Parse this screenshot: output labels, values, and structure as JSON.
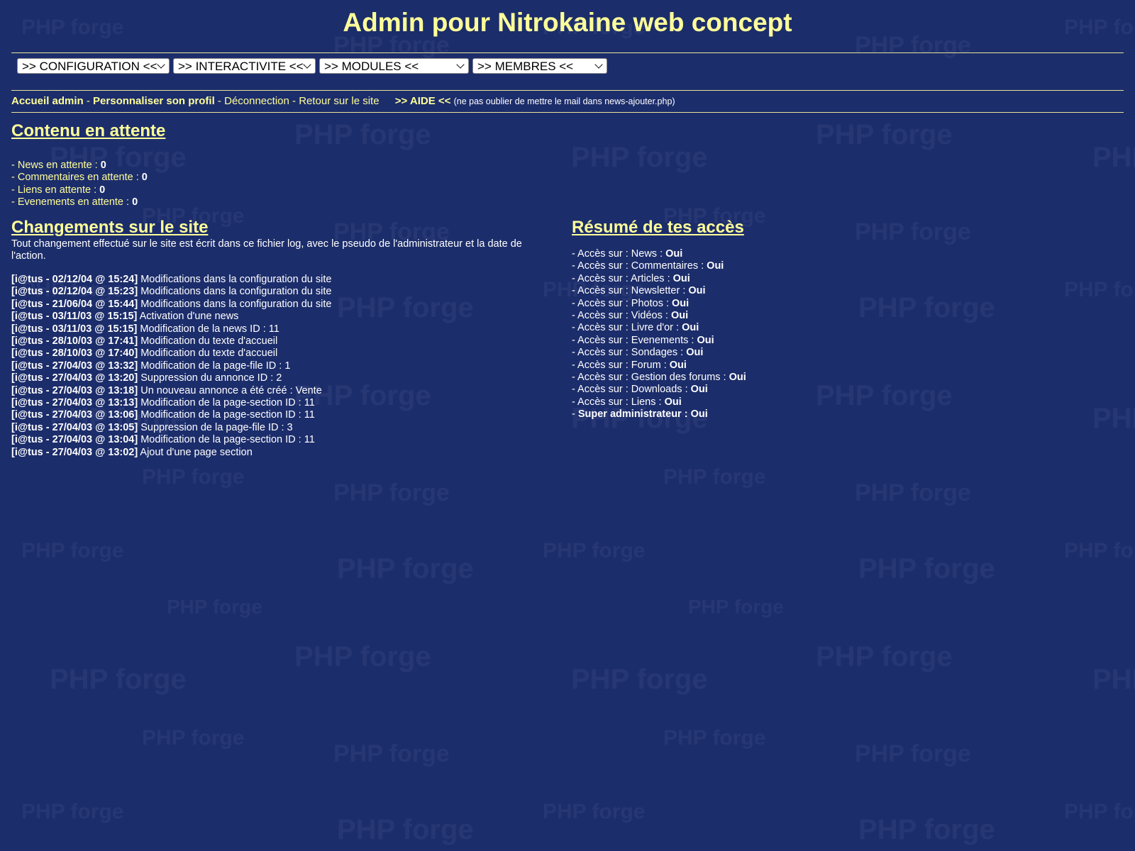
{
  "page_title": "Admin pour Nitrokaine web concept",
  "colors": {
    "background": "#1c2d6b",
    "accent": "#ffff99",
    "text": "#ffffff"
  },
  "watermark_text": "PHP forge",
  "selects": [
    {
      "label": ">> CONFIGURATION <<"
    },
    {
      "label": ">> INTERACTIVITE <<"
    },
    {
      "label": ">> MODULES <<"
    },
    {
      "label": ">> MEMBRES <<"
    }
  ],
  "nav": {
    "accueil": "Accueil admin",
    "profil": "Personnaliser son profil",
    "sep": " - ",
    "deconnection": "Déconnection",
    "retour": "Retour sur le site",
    "aide": ">> AIDE <<",
    "aide_note": "(ne pas oublier de mettre le mail dans news-ajouter.php)"
  },
  "pending": {
    "title": "Contenu en attente",
    "items": [
      {
        "label": "- News en attente : ",
        "value": "0"
      },
      {
        "label": "- Commentaires en attente : ",
        "value": "0"
      },
      {
        "label": "- Liens en attente : ",
        "value": "0"
      },
      {
        "label": "- Evenements en attente : ",
        "value": "0"
      }
    ]
  },
  "changes": {
    "title": "Changements sur le site",
    "description": "Tout changement effectué sur le site est écrit dans ce fichier log, avec le pseudo de l'administrateur et la date de l'action.",
    "entries": [
      {
        "stamp": "[i@tus - 02/12/04 @ 15:24]",
        "text": " Modifications dans la configuration du site"
      },
      {
        "stamp": "[i@tus - 02/12/04 @ 15:23]",
        "text": " Modifications dans la configuration du site"
      },
      {
        "stamp": "[i@tus - 21/06/04 @ 15:44]",
        "text": " Modifications dans la configuration du site"
      },
      {
        "stamp": "[i@tus - 03/11/03 @ 15:15]",
        "text": " Activation d'une news"
      },
      {
        "stamp": "[i@tus - 03/11/03 @ 15:15]",
        "text": " Modification de la news ID : 11"
      },
      {
        "stamp": "[i@tus - 28/10/03 @ 17:41]",
        "text": " Modification du texte d'accueil"
      },
      {
        "stamp": "[i@tus - 28/10/03 @ 17:40]",
        "text": " Modification du texte d'accueil"
      },
      {
        "stamp": "[i@tus - 27/04/03 @ 13:32]",
        "text": " Modification de la page-file ID : 1"
      },
      {
        "stamp": "[i@tus - 27/04/03 @ 13:20]",
        "text": " Suppression du annonce ID : 2"
      },
      {
        "stamp": "[i@tus - 27/04/03 @ 13:18]",
        "text": " Un nouveau annonce a été créé : Vente"
      },
      {
        "stamp": "[i@tus - 27/04/03 @ 13:13]",
        "text": " Modification de la page-section ID : 11"
      },
      {
        "stamp": "[i@tus - 27/04/03 @ 13:06]",
        "text": " Modification de la page-section ID : 11"
      },
      {
        "stamp": "[i@tus - 27/04/03 @ 13:05]",
        "text": " Suppression de la page-file ID : 3"
      },
      {
        "stamp": "[i@tus - 27/04/03 @ 13:04]",
        "text": " Modification de la page-section ID : 11"
      },
      {
        "stamp": "[i@tus - 27/04/03 @ 13:02]",
        "text": " Ajout d'une page section"
      }
    ]
  },
  "access": {
    "title": "Résumé de tes accès",
    "items": [
      {
        "label": "- Accès sur : News : ",
        "value": "Oui"
      },
      {
        "label": "- Accès sur : Commentaires : ",
        "value": "Oui"
      },
      {
        "label": "- Accès sur : Articles : ",
        "value": "Oui"
      },
      {
        "label": "- Accès sur : Newsletter : ",
        "value": "Oui"
      },
      {
        "label": "- Accès sur : Photos : ",
        "value": "Oui"
      },
      {
        "label": "- Accès sur : Vidéos : ",
        "value": "Oui"
      },
      {
        "label": "- Accès sur : Livre d'or : ",
        "value": "Oui"
      },
      {
        "label": "- Accès sur : Evenements : ",
        "value": "Oui"
      },
      {
        "label": "- Accès sur : Sondages : ",
        "value": "Oui"
      },
      {
        "label": "- Accès sur : Forum : ",
        "value": "Oui"
      },
      {
        "label": "- Accès sur : Gestion des forums : ",
        "value": "Oui"
      },
      {
        "label": "- Accès sur : Downloads : ",
        "value": "Oui"
      },
      {
        "label": "- Accès sur : Liens : ",
        "value": "Oui"
      }
    ],
    "super_prefix": "- ",
    "super_label": "Super administrateur : ",
    "super_value": "Oui"
  }
}
